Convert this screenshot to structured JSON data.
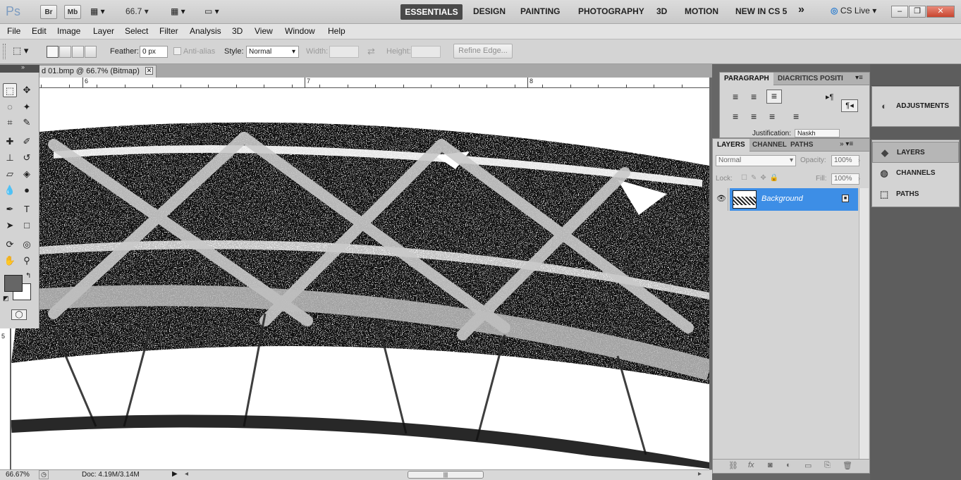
{
  "appbar": {
    "logo": "Ps",
    "bridge_label": "Br",
    "minibridge_label": "Mb",
    "zoom_value": "66.7",
    "workspaces": [
      "ESSENTIALS",
      "DESIGN",
      "PAINTING",
      "PHOTOGRAPHY",
      "3D",
      "MOTION",
      "NEW IN CS 5"
    ],
    "more_label": "»",
    "cslive_label": "CS Live"
  },
  "menu": [
    "File",
    "Edit",
    "Image",
    "Layer",
    "Select",
    "Filter",
    "Analysis",
    "3D",
    "View",
    "Window",
    "Help"
  ],
  "options": {
    "feather_label": "Feather:",
    "feather_value": "0 px",
    "antialias_label": "Anti-alias",
    "style_label": "Style:",
    "style_value": "Normal",
    "width_label": "Width:",
    "height_label": "Height:",
    "refine_label": "Refine Edge..."
  },
  "document": {
    "tab_title": "d 01.bmp @ 66.7% (Bitmap)",
    "ruler_top_numbers": [
      "6",
      "7",
      "8"
    ],
    "ruler_left_number": "5"
  },
  "status": {
    "zoom": "66.67%",
    "doc_info": "Doc: 4.19M/3.14M"
  },
  "paragraph_panel": {
    "tabs": [
      "PARAGRAPH",
      "DIACRITICS POSITI"
    ],
    "justification_label": "Justification:",
    "justification_value": "Naskh"
  },
  "layers_panel": {
    "tabs": [
      "LAYERS",
      "CHANNEL",
      "PATHS"
    ],
    "blend_mode": "Normal",
    "opacity_label": "Opacity:",
    "opacity_value": "100%",
    "lock_label": "Lock:",
    "fill_label": "Fill:",
    "fill_value": "100%",
    "layer_name": "Background"
  },
  "dock": {
    "adjustments": "ADJUSTMENTS",
    "items": [
      "LAYERS",
      "CHANNELS",
      "PATHS"
    ]
  }
}
